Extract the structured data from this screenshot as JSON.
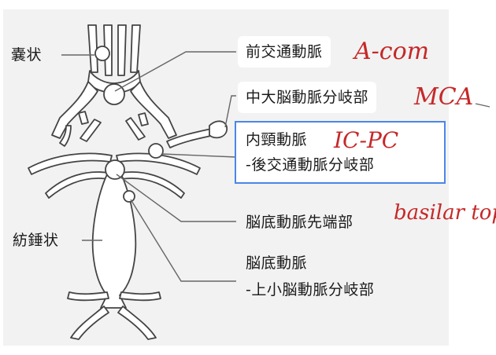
{
  "labels": {
    "saccular": "嚢状",
    "fusiform": "紡錘状",
    "acom": "前交通動脈",
    "mca": "中大脳動脈分岐部",
    "icpc_line1": "内頸動脈",
    "icpc_line2": "-後交通動脈分岐部",
    "basilar_top": "脳底動脈先端部",
    "basilar_sca_line1": "脳底動脈",
    "basilar_sca_line2": "-上小脳動脈分岐部"
  },
  "annotations": {
    "acom": "A-com",
    "mca": "MCA",
    "icpc": "IC-PC",
    "basilar_top": "basilar top"
  },
  "colors": {
    "vessel_stroke": "#444444",
    "vessel_fill": "#ffffff",
    "panel_bg": "#f2f2f2",
    "annotation": "#c62828",
    "highlight_border": "#4a86e8"
  }
}
